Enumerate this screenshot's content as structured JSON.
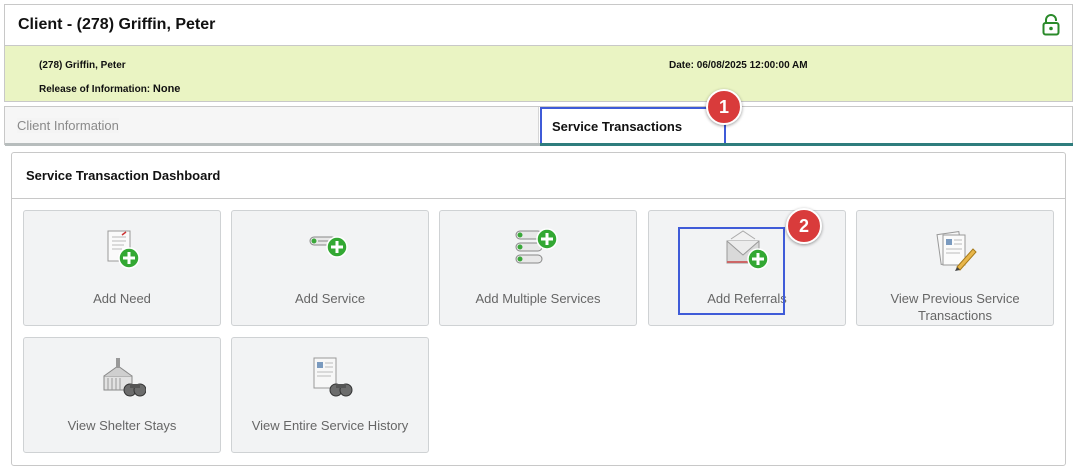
{
  "header": {
    "title": "Client - (278) Griffin, Peter",
    "lock_icon": "lock-icon",
    "client_name": "(278) Griffin, Peter",
    "release_label": "Release of Information:",
    "release_value": "None",
    "date": "Date: 06/08/2025 12:00:00 AM"
  },
  "tabs": [
    {
      "label": "Client Information",
      "active": false
    },
    {
      "label": "Service Transactions",
      "active": true
    }
  ],
  "dashboard": {
    "title": "Service Transaction Dashboard",
    "tiles": [
      {
        "label": "Add Need",
        "icon": "document-add-icon"
      },
      {
        "label": "Add Service",
        "icon": "tag-add-icon"
      },
      {
        "label": "Add Multiple Services",
        "icon": "tags-add-icon"
      },
      {
        "label": "Add Referrals",
        "icon": "envelope-add-icon"
      },
      {
        "label": "View Previous Service Transactions",
        "icon": "document-pencil-icon"
      },
      {
        "label": "View Shelter Stays",
        "icon": "shelter-binoculars-icon"
      },
      {
        "label": "View Entire Service History",
        "icon": "document-binoculars-icon"
      }
    ]
  },
  "annotations": {
    "badge_1": "1",
    "badge_2": "2"
  },
  "colors": {
    "info_band": "#eaf4c3",
    "highlight": "#3f5bd8",
    "badge": "#d93b3b",
    "lock": "#2a8a2a",
    "active_tab_line": "#2e7d7d"
  }
}
